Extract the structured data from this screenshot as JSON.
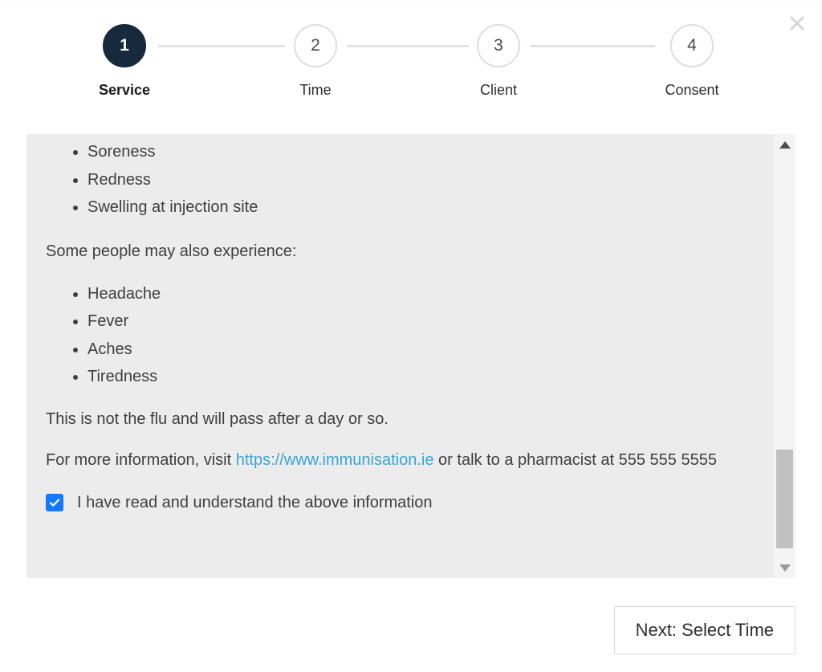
{
  "dialog": {
    "close_icon": "close-icon"
  },
  "stepper": {
    "steps": [
      {
        "number": "1",
        "label": "Service",
        "state": "active"
      },
      {
        "number": "2",
        "label": "Time",
        "state": "inactive"
      },
      {
        "number": "3",
        "label": "Client",
        "state": "inactive"
      },
      {
        "number": "4",
        "label": "Consent",
        "state": "inactive"
      }
    ]
  },
  "content": {
    "side_effects_common": [
      "Soreness",
      "Redness",
      "Swelling at injection site"
    ],
    "intro_secondary": "Some people may also experience:",
    "side_effects_secondary": [
      "Headache",
      "Fever",
      "Aches",
      "Tiredness"
    ],
    "reassurance": "This is not the flu and will pass after a day or so.",
    "more_info_prefix": "For more information, visit ",
    "more_info_link": "https://www.immunisation.ie",
    "more_info_suffix": " or talk to a pharmacist at 555 555 5555",
    "consent_label": "I have read and understand the above information",
    "consent_checked": true
  },
  "scrollbar": {
    "up_icon": "triangle-up-icon",
    "down_icon": "triangle-down-icon"
  },
  "footer": {
    "next_label": "Next: Select Time"
  },
  "colors": {
    "active_step": "#16293d",
    "link": "#3aa5d4",
    "checkbox": "#1479ff",
    "panel_bg": "#ececec"
  }
}
